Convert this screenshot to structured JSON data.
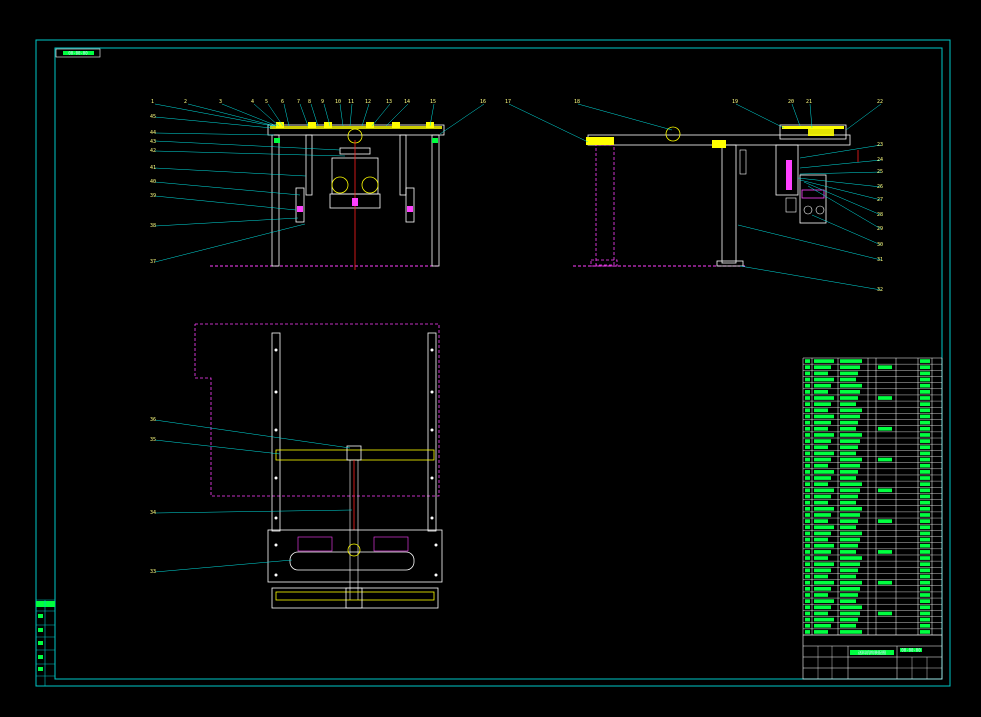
{
  "drawing": {
    "background": "#000000",
    "colors": {
      "frame": "#00c8c8",
      "leader": "#00e0e0",
      "part": "#ffffff",
      "hidden": "#ff40ff",
      "hatch": "#ffff00",
      "green": "#00ff40",
      "red": "#ff2020"
    },
    "drawing_code": "00-00-00",
    "front_view_labels": [
      "1",
      "2",
      "3",
      "4",
      "5",
      "6",
      "7",
      "8",
      "9",
      "10",
      "11",
      "12",
      "13",
      "14",
      "15",
      "16",
      "45",
      "44",
      "43",
      "42",
      "41",
      "40",
      "39",
      "38",
      "37"
    ],
    "side_view_labels": [
      "17",
      "18",
      "19",
      "20",
      "21",
      "22",
      "23",
      "24",
      "25",
      "26",
      "27",
      "28",
      "29",
      "30",
      "31",
      "32"
    ],
    "plan_view_labels": [
      "36",
      "35",
      "34",
      "33"
    ],
    "title_block": {
      "name": "送料机构装配图",
      "code": "00-00-00",
      "side_cells": [
        "标准化",
        "审核",
        "工艺",
        "批准",
        "日期"
      ]
    }
  }
}
